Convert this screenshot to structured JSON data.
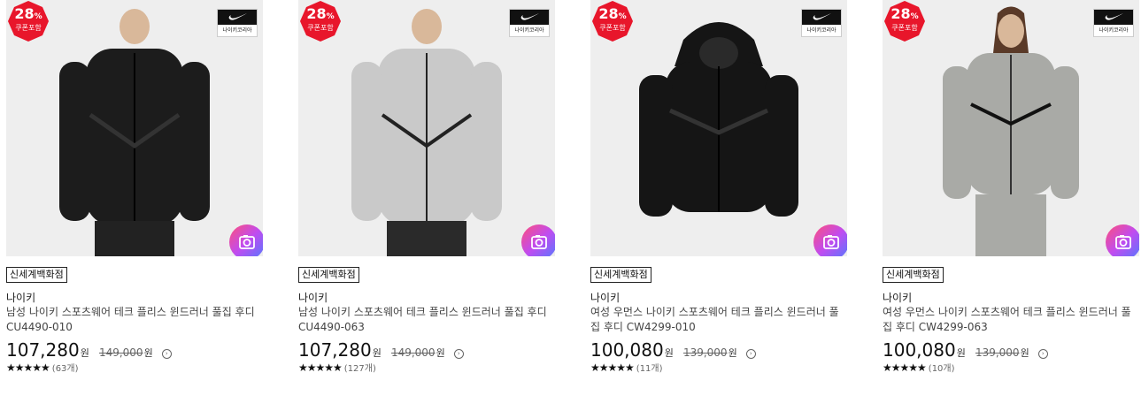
{
  "products": [
    {
      "discount": "28",
      "discount_unit": "%",
      "coupon": "쿠폰포함",
      "brand_label": "나이키코리아",
      "store": "신세계백화점",
      "brand": "나이키",
      "name": "남성 나이키 스포츠웨어 테크 플리스 윈드러너 풀집 후디 CU4490-010",
      "price": "107,280",
      "won": "원",
      "original_price": "149,000",
      "stars": "★★★★★",
      "reviews": "(63개)",
      "jacket_color": "#1c1c1c",
      "bg_color": "#eeeeee"
    },
    {
      "discount": "28",
      "discount_unit": "%",
      "coupon": "쿠폰포함",
      "brand_label": "나이키코리아",
      "store": "신세계백화점",
      "brand": "나이키",
      "name": "남성 나이키 스포츠웨어 테크 플리스 윈드러너 풀집 후디 CU4490-063",
      "price": "107,280",
      "won": "원",
      "original_price": "149,000",
      "stars": "★★★★★",
      "reviews": "(127개)",
      "jacket_color": "#c9c9c9",
      "bg_color": "#eeeeee"
    },
    {
      "discount": "28",
      "discount_unit": "%",
      "coupon": "쿠폰포함",
      "brand_label": "나이키코리아",
      "store": "신세계백화점",
      "brand": "나이키",
      "name": "여성 우먼스 나이키 스포츠웨어 테크 플리스 윈드러너 풀집 후디 CW4299-010",
      "price": "100,080",
      "won": "원",
      "original_price": "139,000",
      "stars": "★★★★★",
      "reviews": "(11개)",
      "jacket_color": "#151515",
      "bg_color": "#eeeeee"
    },
    {
      "discount": "28",
      "discount_unit": "%",
      "coupon": "쿠폰포함",
      "brand_label": "나이키코리아",
      "store": "신세계백화점",
      "brand": "나이키",
      "name": "여성 우먼스 나이키 스포츠웨어 테크 플리스 윈드러너 풀집 후디 CW4299-063",
      "price": "100,080",
      "won": "원",
      "original_price": "139,000",
      "stars": "★★★★★",
      "reviews": "(10개)",
      "jacket_color": "#a9aaa6",
      "bg_color": "#eeeeee"
    }
  ],
  "colors": {
    "discount_badge": "#e8162b",
    "stars": "#111111"
  },
  "icons": {
    "camera": "camera-search-icon",
    "info": "info-circle-icon",
    "logo": "nike-swoosh-icon"
  }
}
